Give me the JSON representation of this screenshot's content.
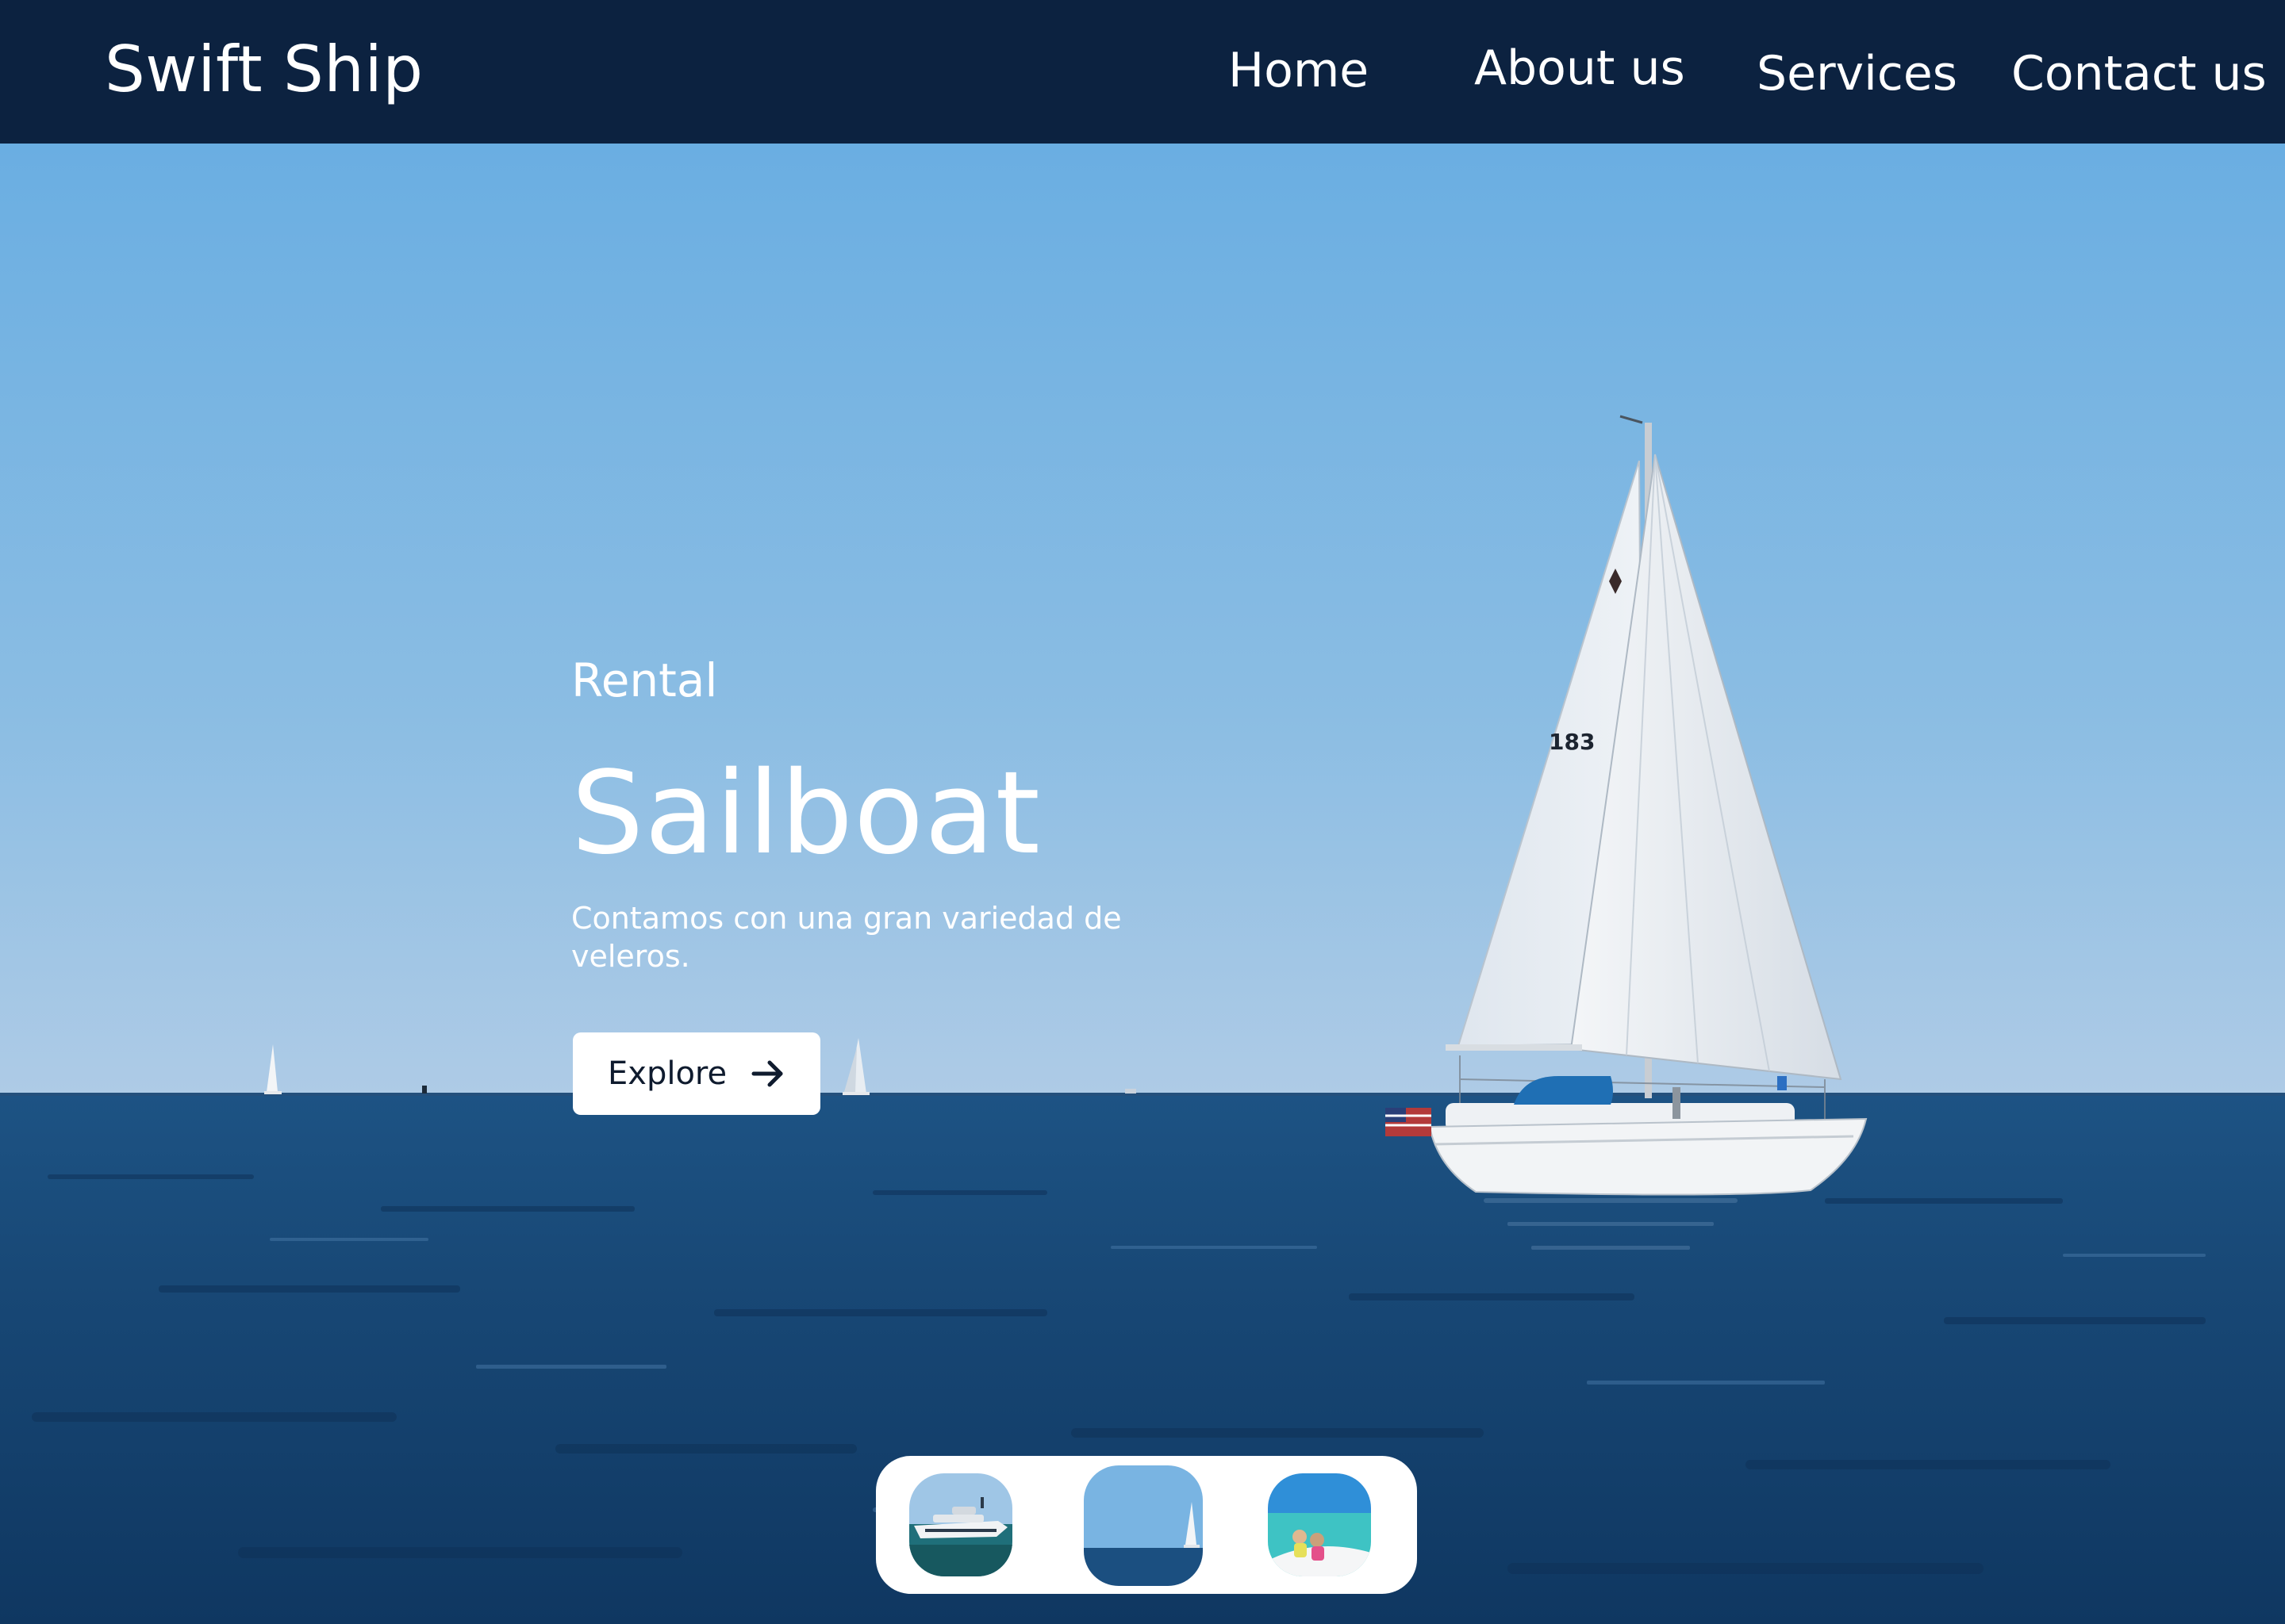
{
  "header": {
    "brand": "Swift Ship",
    "nav": {
      "home": "Home",
      "about": "About us",
      "services": "Services",
      "contact": "Contact us"
    }
  },
  "hero": {
    "eyebrow": "Rental",
    "title": "Sailboat",
    "description": "Contamos con una gran variedad de veleros.",
    "button": {
      "label": "Explore",
      "icon": "arrow-right-icon"
    },
    "sail_number": "183"
  },
  "gallery": {
    "thumbnails": [
      {
        "name": "yacht"
      },
      {
        "name": "sailboat"
      },
      {
        "name": "boat-deck"
      }
    ]
  },
  "colors": {
    "nav_background": "#0c2240",
    "sky": "#6fb2e2",
    "sea": "#1c4e7e",
    "button_bg": "#ffffff",
    "text": "#ffffff"
  }
}
